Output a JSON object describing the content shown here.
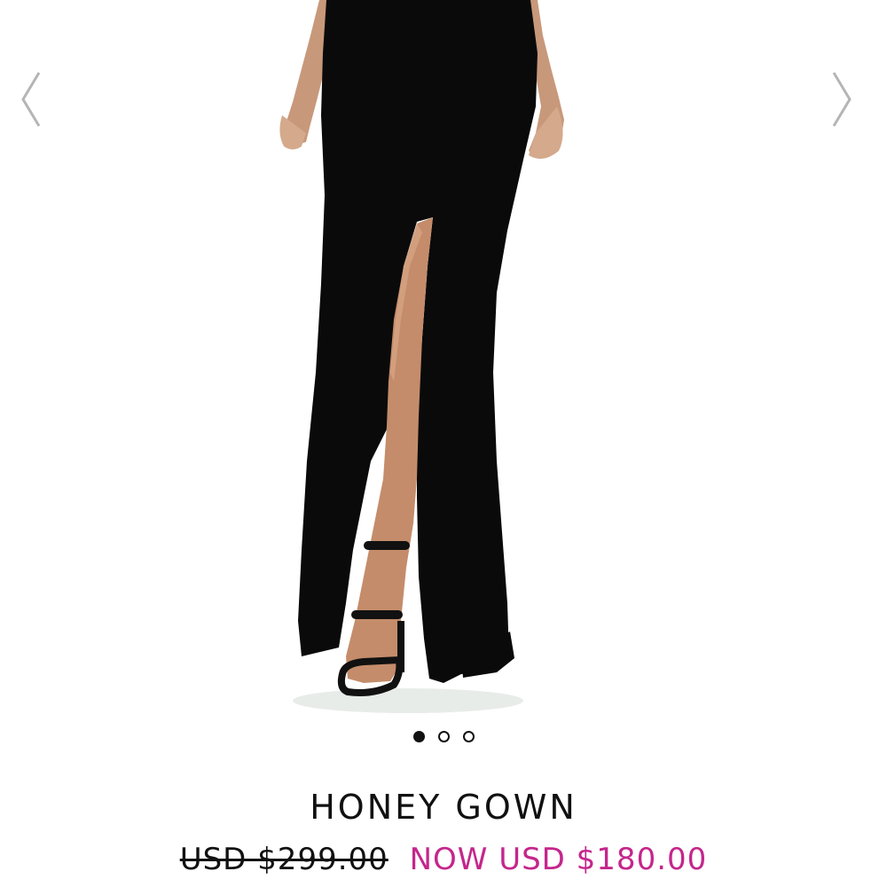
{
  "colors": {
    "text": "#111111",
    "sale_price": "#c4268c",
    "background": "#ffffff"
  },
  "carousel": {
    "prev_icon": "chevron-left-icon",
    "next_icon": "chevron-right-icon",
    "slide_count": 3,
    "active_index": 0
  },
  "product": {
    "image_alt": "black maxi gown with thigh slit and strappy black sandals",
    "title": "HONEY GOWN",
    "original_price": "USD $299.00",
    "sale_price": "NOW USD $180.00"
  }
}
